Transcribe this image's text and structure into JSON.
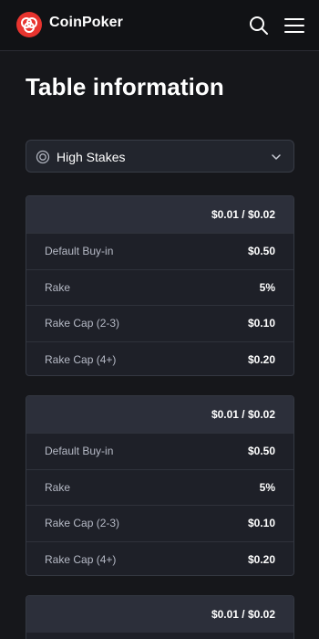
{
  "header": {
    "brand": "CoinPoker",
    "icons": {
      "logo": "coinpoker-logo",
      "search": "search-icon",
      "menu": "hamburger-menu-icon"
    },
    "brand_color": "#e8342f"
  },
  "page": {
    "title": "Table information"
  },
  "stakes_select": {
    "value": "High Stakes",
    "icon": "chip-icon",
    "chevron": "chevron-down-icon"
  },
  "cards": [
    {
      "stake": "$0.01 / $0.02",
      "rows": [
        {
          "label": "Default Buy-in",
          "value": "$0.50"
        },
        {
          "label": "Rake",
          "value": "5%"
        },
        {
          "label": "Rake Cap (2-3)",
          "value": "$0.10"
        },
        {
          "label": "Rake Cap (4+)",
          "value": "$0.20"
        }
      ]
    },
    {
      "stake": "$0.01 / $0.02",
      "rows": [
        {
          "label": "Default Buy-in",
          "value": "$0.50"
        },
        {
          "label": "Rake",
          "value": "5%"
        },
        {
          "label": "Rake Cap (2-3)",
          "value": "$0.10"
        },
        {
          "label": "Rake Cap (4+)",
          "value": "$0.20"
        }
      ]
    },
    {
      "stake": "$0.01 / $0.02",
      "rows": []
    }
  ]
}
